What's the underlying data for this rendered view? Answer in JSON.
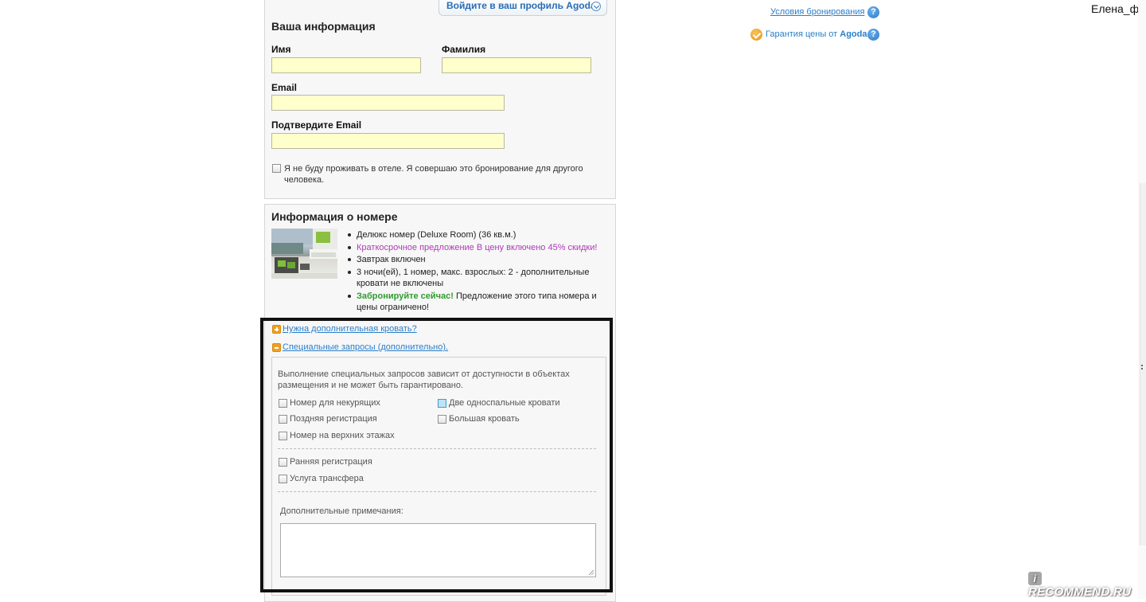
{
  "your_info": {
    "title": "Ваша информация",
    "login_button": "Войдите в ваш профиль Agoda",
    "first_name_label": "Имя",
    "last_name_label": "Фамилия",
    "email_label": "Email",
    "confirm_email_label": "Подтвердите Email",
    "not_staying_text": "Я не буду проживать в отеле. Я совершаю это бронирование для другого человека."
  },
  "room_info": {
    "title": "Информация о номере",
    "bullets": {
      "room": "Делюкс номер (Deluxe Room) (36 кв.м.)",
      "promo": "Краткосрочное предложение В цену включено 45% скидки!",
      "breakfast": "Завтрак включен",
      "occupancy": "3 ночи(ей), 1 номер, макс. взрослых: 2 - дополнительные кровати не включены",
      "book_now_bold": "Забронируйте сейчас!",
      "book_now_rest": " Предложение этого типа номера и цены ограничено!"
    }
  },
  "extras": {
    "extra_bed_link": "Нужна дополнительная кровать?",
    "special_requests_link": "Специальные запросы (дополнительно).",
    "notice": "Выполнение специальных запросов зависит от доступности в объектах размещения и не может быть гарантировано.",
    "options": {
      "non_smoking": "Номер для некурящих",
      "late_checkin": "Поздняя регистрация",
      "high_floor": "Номер на верхних этажах",
      "twin_beds": "Две односпальные кровати",
      "large_bed": "Большая кровать",
      "early_checkin": "Ранняя регистрация",
      "transfer": "Услуга трансфера"
    },
    "notes_label": "Дополнительные примечания:"
  },
  "sidebar": {
    "booking_terms": "Условия бронирования",
    "price_guarantee_prefix": "Гарантия цены от ",
    "price_guarantee_brand": "Agoda"
  },
  "user": {
    "name": "Елена_фк"
  },
  "watermark": {
    "icon_letter": "i",
    "text": "RECOMMEND.RU"
  },
  "colors": {
    "input_bg": "#ffffcc",
    "link": "#2a7fc9",
    "promo": "#b03ab8",
    "book_now": "#2f9c2f",
    "accent_icon": "#f0a020"
  }
}
